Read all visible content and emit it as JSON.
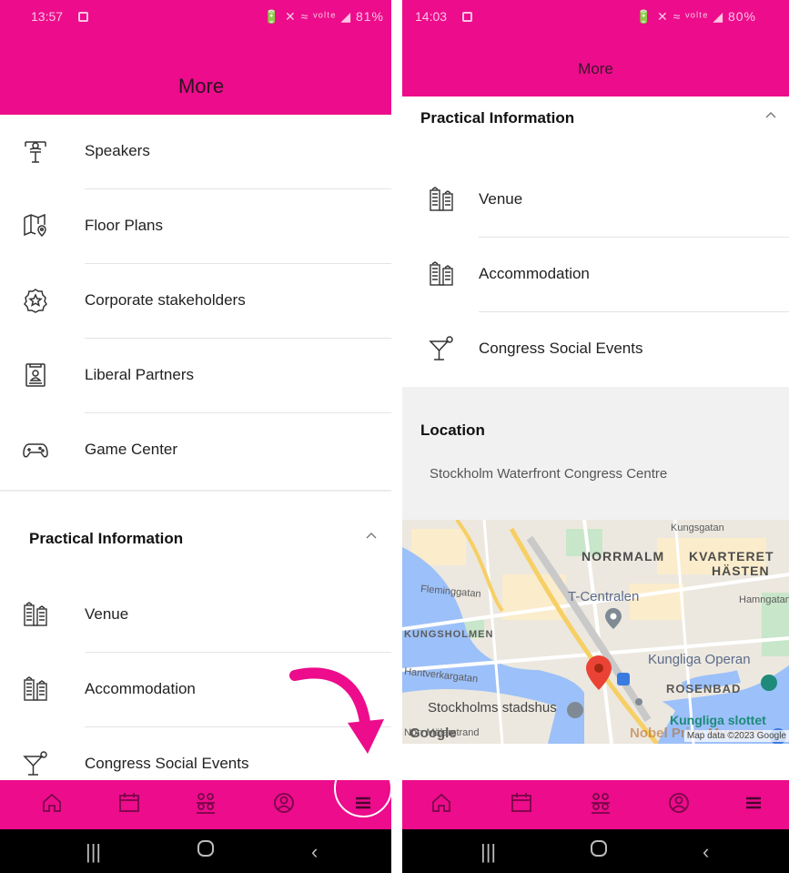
{
  "left_screen": {
    "status": {
      "time": "13:57",
      "icons": "🔋 ✕ ≈ ᵛᵒˡᵗᵉ ◢ 81%"
    },
    "header": {
      "title": "More"
    },
    "menu_items": [
      {
        "label": "Speakers",
        "icon": "speaker-podium-icon"
      },
      {
        "label": "Floor Plans",
        "icon": "map-pin-icon"
      },
      {
        "label": "Corporate stakeholders",
        "icon": "star-badge-icon"
      },
      {
        "label": "Liberal Partners",
        "icon": "id-card-icon"
      },
      {
        "label": "Game Center",
        "icon": "gamepad-icon"
      }
    ],
    "practical_section": {
      "title": "Practical Information",
      "items": [
        {
          "label": "Venue",
          "icon": "buildings-icon"
        },
        {
          "label": "Accommodation",
          "icon": "buildings-icon"
        },
        {
          "label": "Congress Social Events",
          "icon": "cocktail-icon"
        }
      ]
    }
  },
  "right_screen": {
    "status": {
      "time": "14:03",
      "icons": "🔋 ✕ ≈ ᵛᵒˡᵗᵉ ◢ 80%"
    },
    "header": {
      "title": "More"
    },
    "practical_section": {
      "title": "Practical Information",
      "items": [
        {
          "label": "Venue",
          "icon": "buildings-icon"
        },
        {
          "label": "Accommodation",
          "icon": "buildings-icon"
        },
        {
          "label": "Congress Social Events",
          "icon": "cocktail-icon"
        }
      ]
    },
    "location": {
      "heading": "Location",
      "address": "Stockholm Waterfront Congress Centre"
    },
    "map": {
      "labels": {
        "kungsgatan": "Kungsgatan",
        "normalm": "NORRMALM",
        "kvarteret": "KVARTERET",
        "hasten": "HÄSTEN",
        "fleminggatan": "Fleminggatan",
        "tcentralen": "T-Centralen",
        "hamngatan": "Hamngatan",
        "kungsholmen": "KUNGSHOLMEN",
        "operan": "Kungliga Operan",
        "hantverkargatan": "Hantverkargatan",
        "rosenbad": "ROSENBAD",
        "stadshus": "Stockholms stadshus",
        "slottet": "Kungliga slottet",
        "malarstrand": "Norr Mälarstrand",
        "nobel": "Nobel Prize Museum",
        "google": "Google",
        "credit": "Map data ©2023 Google"
      },
      "colors": {
        "water": "#9cc0f9",
        "park": "#c8e6c9",
        "road": "#ffffff",
        "highway": "#f6cf65",
        "pin": "#ea4335"
      }
    }
  },
  "tabbar": {
    "tabs": [
      {
        "name": "home",
        "icon": "home-icon"
      },
      {
        "name": "schedule",
        "icon": "calendar-icon"
      },
      {
        "name": "people",
        "icon": "people-icon"
      },
      {
        "name": "profile",
        "icon": "profile-icon"
      },
      {
        "name": "more",
        "icon": "menu-icon"
      }
    ]
  },
  "theme": {
    "accent": "#ec0c8c",
    "text": "#222222",
    "divider": "#e4e4e4"
  }
}
